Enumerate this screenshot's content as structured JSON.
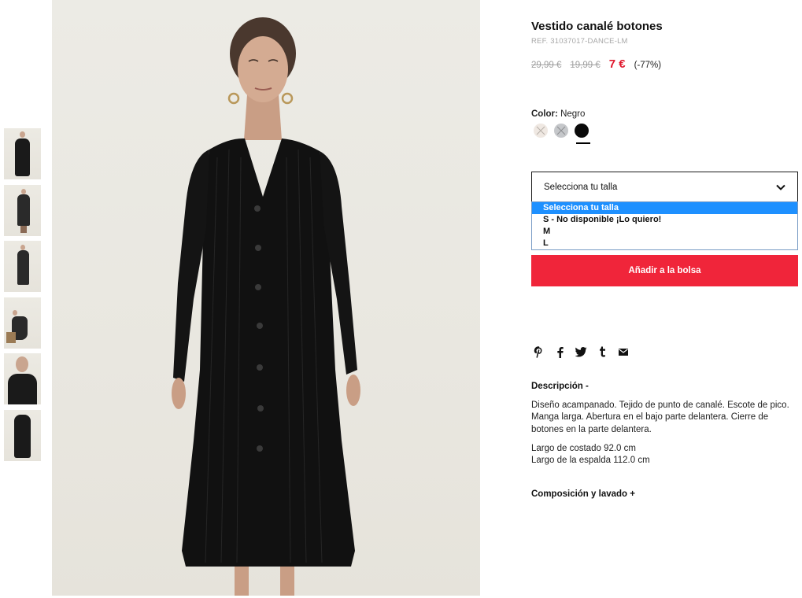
{
  "product": {
    "title": "Vestido canalé botones",
    "ref": "REF. 31037017-DANCE-LM",
    "price_original": "29,99 €",
    "price_previous": "19,99 €",
    "price_current": "7 €",
    "discount": "(-77%)"
  },
  "color": {
    "label": "Color:",
    "value": "Negro",
    "swatches": [
      {
        "name": "light",
        "color": "#efe8e2",
        "available": false
      },
      {
        "name": "grey",
        "color": "#c5c7ca",
        "available": false
      },
      {
        "name": "black",
        "color": "#0a0a0a",
        "available": true,
        "selected": true
      }
    ]
  },
  "size_select": {
    "value": "Selecciona tu talla",
    "options": [
      "Selecciona tu talla",
      "S - No disponible ¡Lo quiero!",
      "M",
      "L"
    ],
    "highlighted_index": 0
  },
  "add_to_bag": "Añadir a la bolsa",
  "share_icons": [
    "pinterest-icon",
    "facebook-icon",
    "twitter-icon",
    "tumblr-icon",
    "email-icon"
  ],
  "description": {
    "heading": "Descripción -",
    "paragraphs": [
      "Diseño acampanado. Tejido de punto de canalé. Escote de pico. Manga larga. Abertura en el bajo parte delantera. Cierre de botones en la parte delantera.",
      "Largo de costado 92.0 cm\nLargo de la espalda 112.0 cm"
    ]
  },
  "composition_heading": "Composición y lavado +",
  "colors": {
    "accent_red": "#f0253a",
    "price_red": "#e0182d",
    "highlight_blue": "#1e90ff"
  }
}
